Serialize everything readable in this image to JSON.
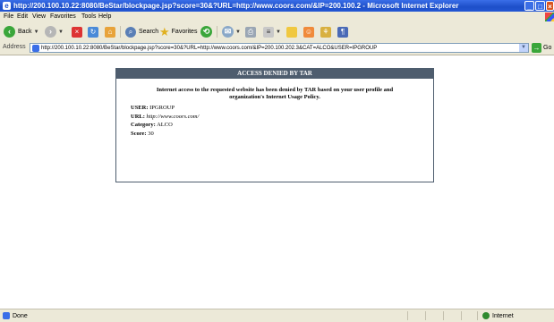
{
  "window": {
    "title": "http://200.100.10.22:8080/BeStar/blockpage.jsp?score=30&?URL=http://www.coors.com/&IP=200.100.2 - Microsoft Internet Explorer"
  },
  "menu": [
    "File",
    "Edit",
    "View",
    "Favorites",
    "Tools",
    "Help"
  ],
  "toolbar": {
    "back_label": "Back",
    "search_label": "Search",
    "favorites_label": "Favorites"
  },
  "address": {
    "label": "Address",
    "url": "http://200.100.10.22:8080/BeStar/blockpage.jsp?score=30&?URL=http://www.coors.com/&IP=200.100.202.3&CAT=ALCO&USER=IPGROUP",
    "go_label": "Go"
  },
  "block_page": {
    "header": "ACCESS DENIED BY TAR",
    "message": "Internet access to the requested website has been denied by TAR based on your user profile and organization's Internet Usage Policy.",
    "rows": [
      {
        "label": "USER:",
        "value": "IPGROUP"
      },
      {
        "label": "URL:",
        "value": "http://www.coors.com/"
      },
      {
        "label": "Category:",
        "value": "ALCO"
      },
      {
        "label": "Score:",
        "value": "30"
      }
    ]
  },
  "status": {
    "left": "Done",
    "zone": "Internet"
  },
  "colors": {
    "titlebar": "#1d4fc9",
    "chrome": "#ece9d8",
    "block_header": "#4e5d6e"
  }
}
